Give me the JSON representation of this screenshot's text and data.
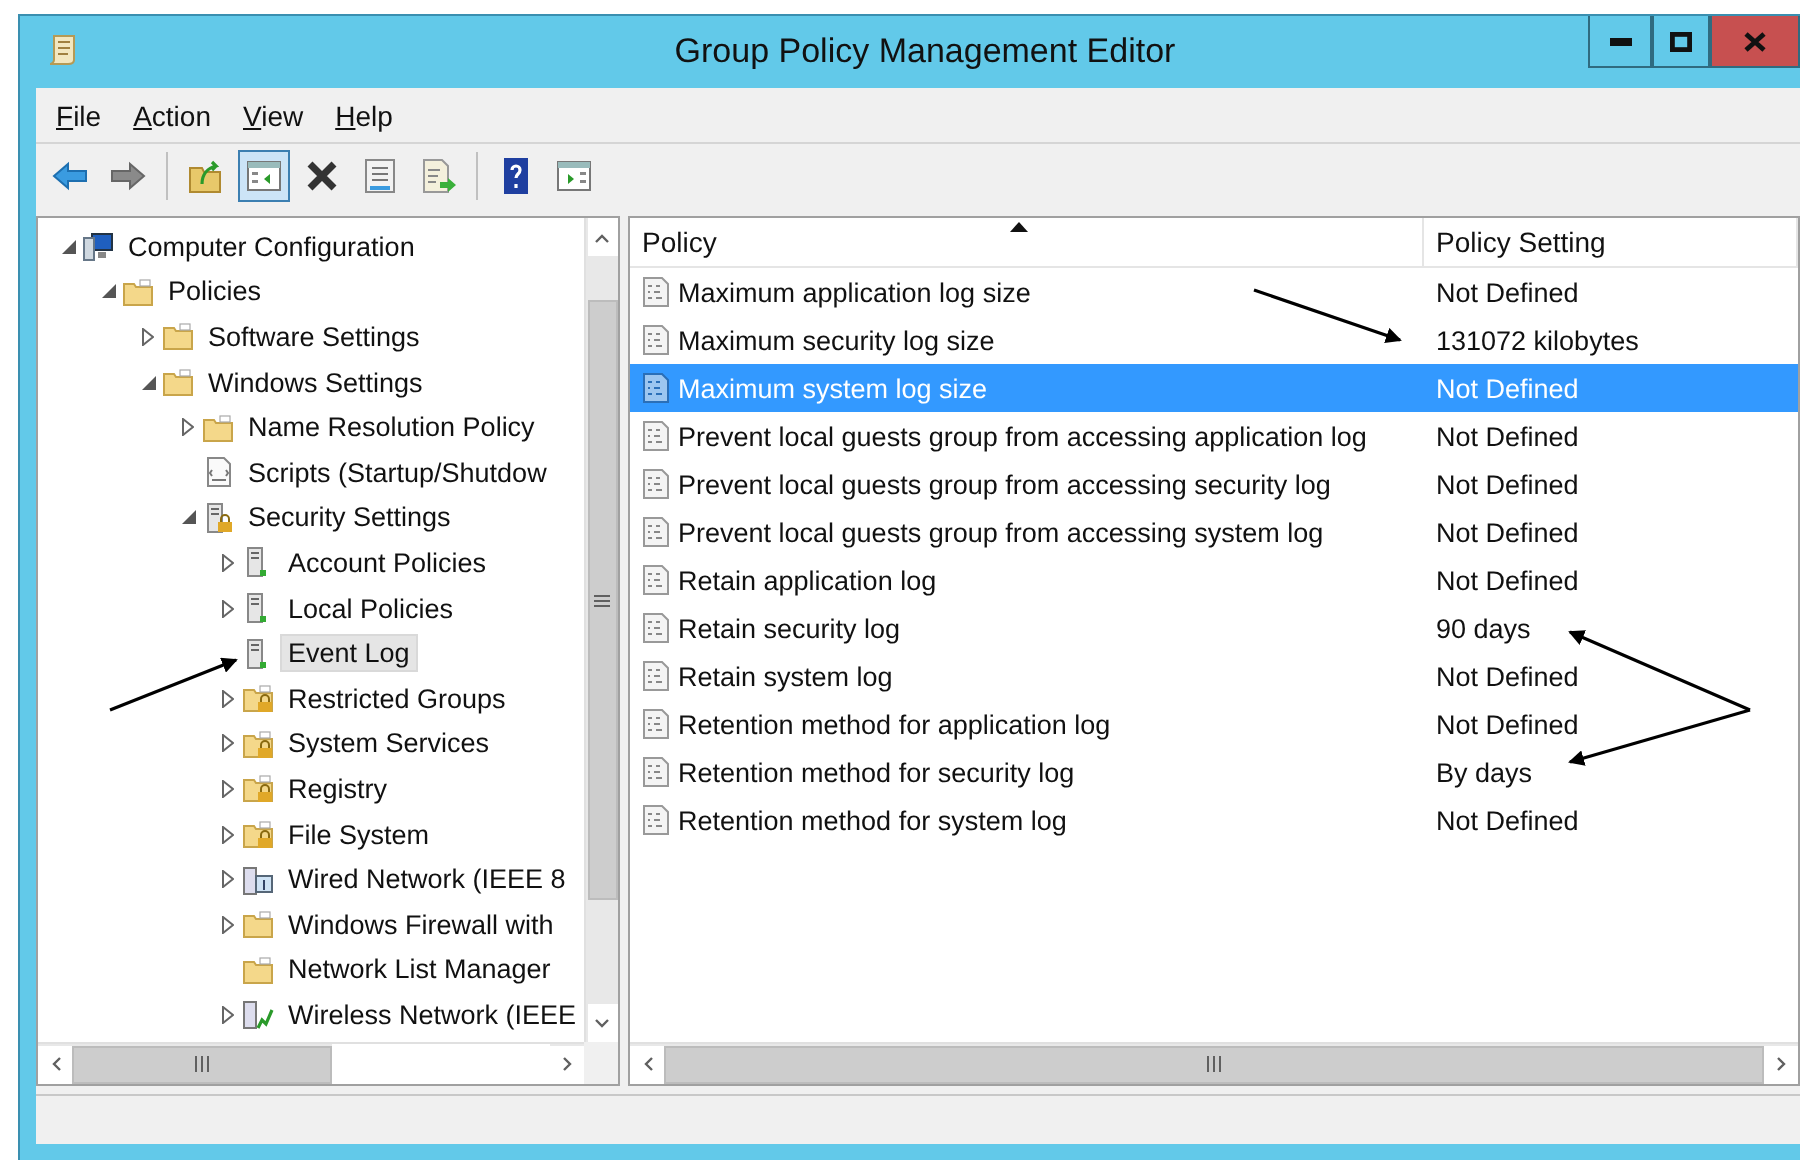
{
  "window": {
    "title": "Group Policy Management Editor"
  },
  "menu": [
    {
      "label": "File"
    },
    {
      "label": "Action"
    },
    {
      "label": "View"
    },
    {
      "label": "Help"
    }
  ],
  "toolbar": [
    {
      "kind": "back",
      "pressed": false
    },
    {
      "kind": "forward",
      "pressed": false
    },
    {
      "kind": "up",
      "pressed": false
    },
    {
      "kind": "console-tree",
      "pressed": true
    },
    {
      "kind": "delete",
      "pressed": false
    },
    {
      "kind": "properties",
      "pressed": false
    },
    {
      "kind": "export",
      "pressed": false
    },
    {
      "kind": "help",
      "pressed": false
    },
    {
      "kind": "action-pane",
      "pressed": false
    }
  ],
  "tree": [
    {
      "label": "Computer Configuration",
      "kind": "computer",
      "expanded": true,
      "leaf": false,
      "selected": false,
      "children": [
        {
          "label": "Policies",
          "kind": "folder",
          "expanded": true,
          "leaf": false,
          "selected": false,
          "children": [
            {
              "label": "Software Settings",
              "kind": "folder",
              "expanded": false,
              "leaf": false,
              "selected": false
            },
            {
              "label": "Windows Settings",
              "kind": "folder",
              "expanded": true,
              "leaf": false,
              "selected": false,
              "children": [
                {
                  "label": "Name Resolution Policy",
                  "kind": "folder",
                  "expanded": false,
                  "leaf": false,
                  "selected": false
                },
                {
                  "label": "Scripts (Startup/Shutdow",
                  "kind": "script",
                  "expanded": false,
                  "leaf": true,
                  "selected": false
                },
                {
                  "label": "Security Settings",
                  "kind": "locked-server",
                  "expanded": true,
                  "leaf": false,
                  "selected": false,
                  "children": [
                    {
                      "label": "Account Policies",
                      "kind": "server",
                      "expanded": false,
                      "leaf": false,
                      "selected": false
                    },
                    {
                      "label": "Local Policies",
                      "kind": "server",
                      "expanded": false,
                      "leaf": false,
                      "selected": false
                    },
                    {
                      "label": "Event Log",
                      "kind": "server",
                      "expanded": false,
                      "leaf": true,
                      "selected": true
                    },
                    {
                      "label": "Restricted Groups",
                      "kind": "locked-folder",
                      "expanded": false,
                      "leaf": false,
                      "selected": false
                    },
                    {
                      "label": "System Services",
                      "kind": "locked-folder",
                      "expanded": false,
                      "leaf": false,
                      "selected": false
                    },
                    {
                      "label": "Registry",
                      "kind": "locked-folder",
                      "expanded": false,
                      "leaf": false,
                      "selected": false
                    },
                    {
                      "label": "File System",
                      "kind": "locked-folder",
                      "expanded": false,
                      "leaf": false,
                      "selected": false
                    },
                    {
                      "label": "Wired Network (IEEE 8",
                      "kind": "network",
                      "expanded": false,
                      "leaf": false,
                      "selected": false
                    },
                    {
                      "label": "Windows Firewall with",
                      "kind": "folder",
                      "expanded": false,
                      "leaf": false,
                      "selected": false
                    },
                    {
                      "label": "Network List Manager",
                      "kind": "folder",
                      "expanded": false,
                      "leaf": true,
                      "selected": false
                    },
                    {
                      "label": "Wireless Network (IEEE",
                      "kind": "wireless",
                      "expanded": false,
                      "leaf": false,
                      "selected": false
                    }
                  ]
                }
              ]
            }
          ]
        }
      ]
    }
  ],
  "table": {
    "columns": [
      "Policy",
      "Policy Setting"
    ],
    "rows": [
      {
        "policy": "Maximum application log size",
        "setting": "Not Defined",
        "selected": false
      },
      {
        "policy": "Maximum security log size",
        "setting": "131072 kilobytes",
        "selected": false
      },
      {
        "policy": "Maximum system log size",
        "setting": "Not Defined",
        "selected": true
      },
      {
        "policy": "Prevent local guests group from accessing application log",
        "setting": "Not Defined",
        "selected": false
      },
      {
        "policy": "Prevent local guests group from accessing security log",
        "setting": "Not Defined",
        "selected": false
      },
      {
        "policy": "Prevent local guests group from accessing system log",
        "setting": "Not Defined",
        "selected": false
      },
      {
        "policy": "Retain application log",
        "setting": "Not Defined",
        "selected": false
      },
      {
        "policy": "Retain security log",
        "setting": "90 days",
        "selected": false
      },
      {
        "policy": "Retain system log",
        "setting": "Not Defined",
        "selected": false
      },
      {
        "policy": "Retention method for application log",
        "setting": "Not Defined",
        "selected": false
      },
      {
        "policy": "Retention method for security log",
        "setting": "By days",
        "selected": false
      },
      {
        "policy": "Retention method for system log",
        "setting": "Not Defined",
        "selected": false
      }
    ]
  }
}
